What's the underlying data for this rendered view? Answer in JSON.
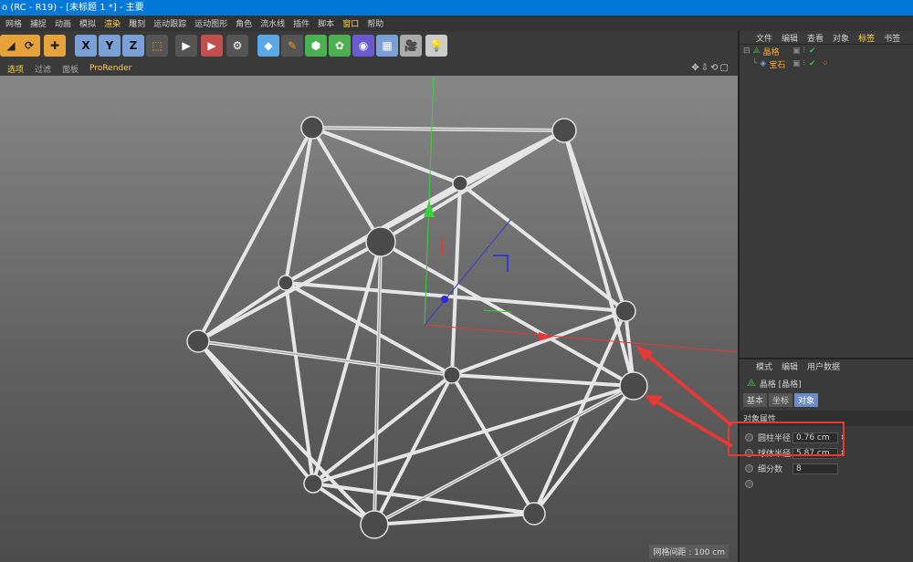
{
  "window": {
    "title": "o (RC - R19) - [未标题 1 *] - 主要"
  },
  "menu": [
    "网格",
    "捕捉",
    "动画",
    "模拟",
    "渲染",
    "雕刻",
    "运动跟踪",
    "运动图形",
    "角色",
    "流水线",
    "插件",
    "脚本",
    "窗口",
    "帮助"
  ],
  "toolbar": {
    "x_label": "X",
    "y_label": "Y",
    "z_label": "Z"
  },
  "viewport_menu": [
    "选项",
    "过滤",
    "面板",
    "ProRender"
  ],
  "viewport": {
    "grid_spacing": "网格间距 : 100 cm"
  },
  "object_manager": {
    "menu": [
      "文件",
      "编辑",
      "查看",
      "对象",
      "标签",
      "书签"
    ],
    "objects": [
      {
        "name": "晶格",
        "icon": "lattice-icon"
      },
      {
        "name": "宝石",
        "icon": "gem-icon"
      }
    ]
  },
  "attribute_manager": {
    "menu": [
      "模式",
      "编辑",
      "用户数据"
    ],
    "object_title": "晶格 [晶格]",
    "tabs": [
      "基本",
      "坐标",
      "对象"
    ],
    "section": "对象属性",
    "params": [
      {
        "label": "圆柱半径",
        "value": "0.76 cm"
      },
      {
        "label": "球体半径",
        "value": "5.87 cm"
      },
      {
        "label": "细分数",
        "value": "8"
      }
    ]
  },
  "colors": {
    "accent": "#ffd24a",
    "titlebar": "#0078d7",
    "annotation": "#e53935"
  }
}
